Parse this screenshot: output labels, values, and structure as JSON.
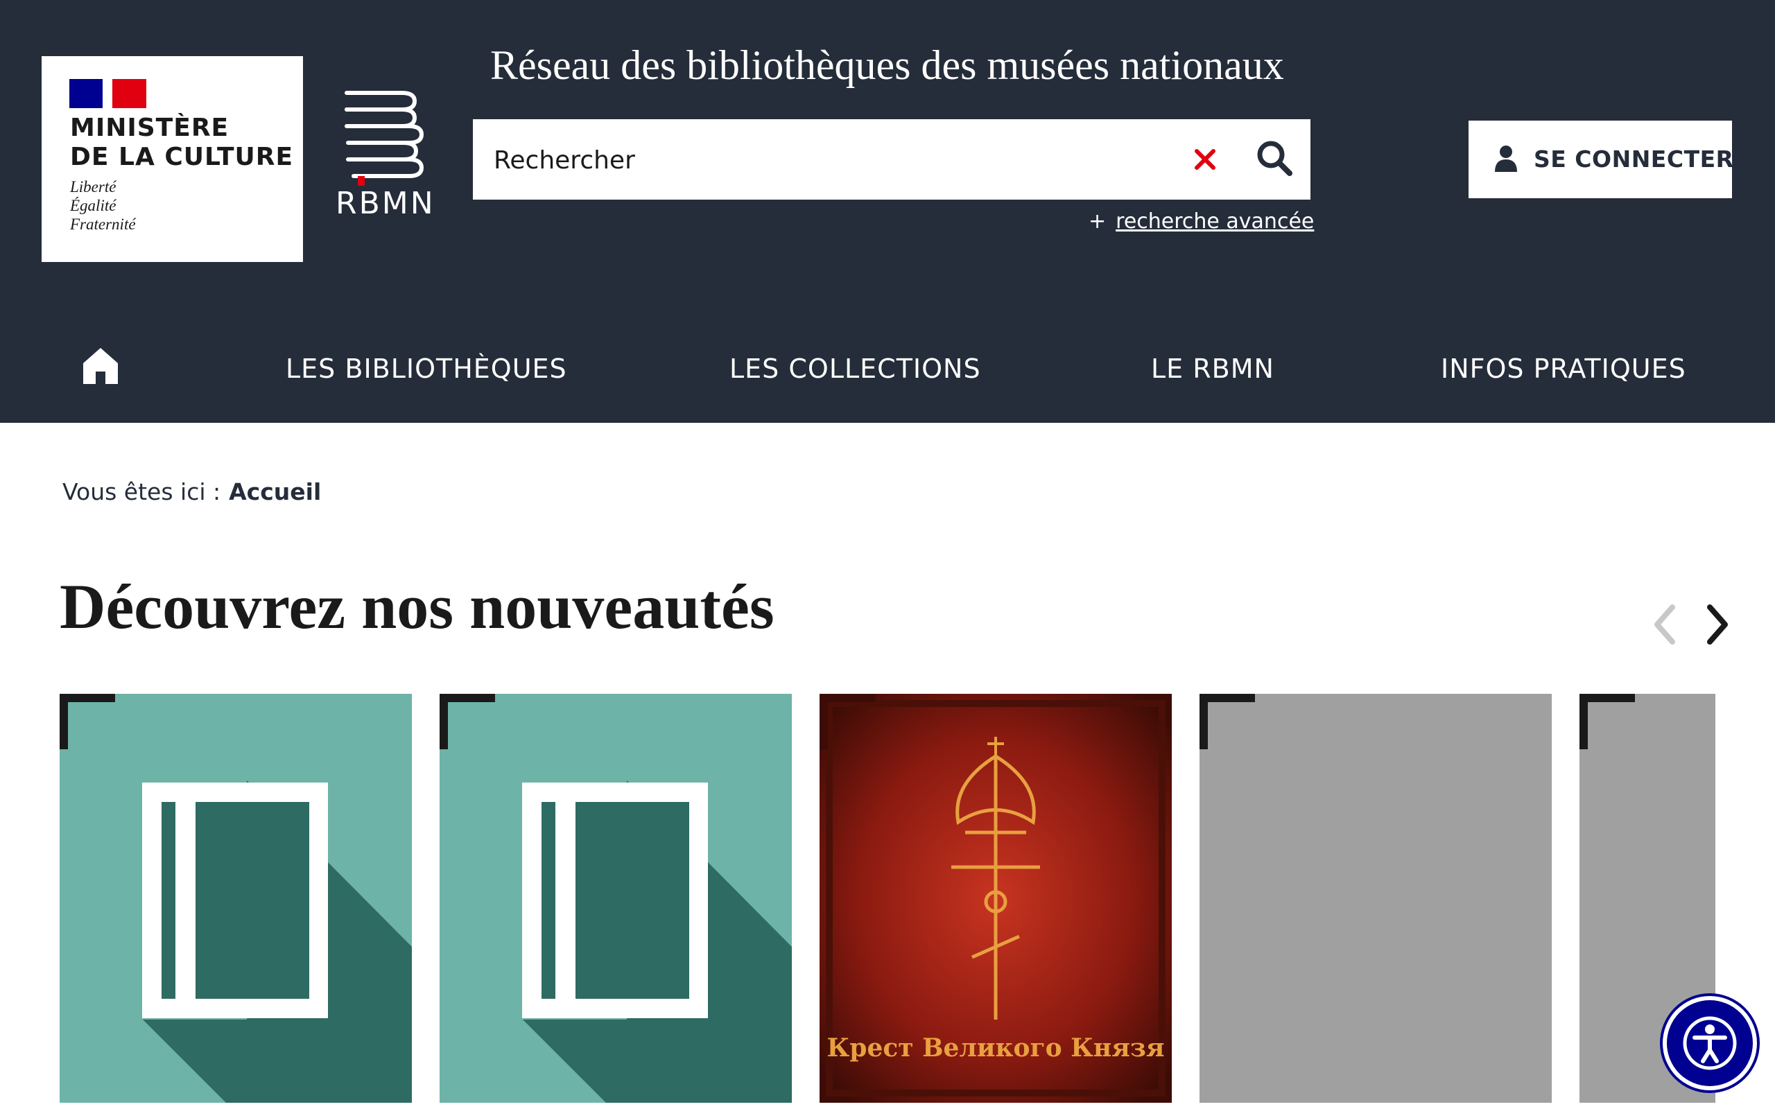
{
  "header": {
    "ministere": {
      "line1": "MINISTÈRE",
      "line2": "DE LA CULTURE",
      "devise1": "Liberté",
      "devise2": "Égalité",
      "devise3": "Fraternité"
    },
    "rbmn_logo_text": "RBMN",
    "site_title": "Réseau des bibliothèques des musées nationaux",
    "search": {
      "placeholder": "Rechercher"
    },
    "advanced_search": "recherche avancée",
    "advanced_plus": "+",
    "connect_label": "SE CONNECTER"
  },
  "nav": {
    "items": [
      "LES BIBLIOTHÈQUES",
      "LES COLLECTIONS",
      "LE RBMN",
      "INFOS PRATIQUES"
    ]
  },
  "breadcrumb": {
    "prefix": "Vous êtes ici :",
    "current": "Accueil"
  },
  "section": {
    "title": "Découvrez nos nouveautés"
  },
  "cards": [
    {
      "type": "placeholder-book",
      "color": "#6db3a8"
    },
    {
      "type": "placeholder-book",
      "color": "#6db3a8"
    },
    {
      "type": "cover",
      "cover_text": "Крест Великого Князя",
      "color": "#8a1a10"
    },
    {
      "type": "grey",
      "color": "#a0a0a0"
    },
    {
      "type": "grey",
      "color": "#a0a0a0"
    }
  ],
  "colors": {
    "header_bg": "#252d3a",
    "accent_red": "#e1000f",
    "marianne_blue": "#000091"
  }
}
